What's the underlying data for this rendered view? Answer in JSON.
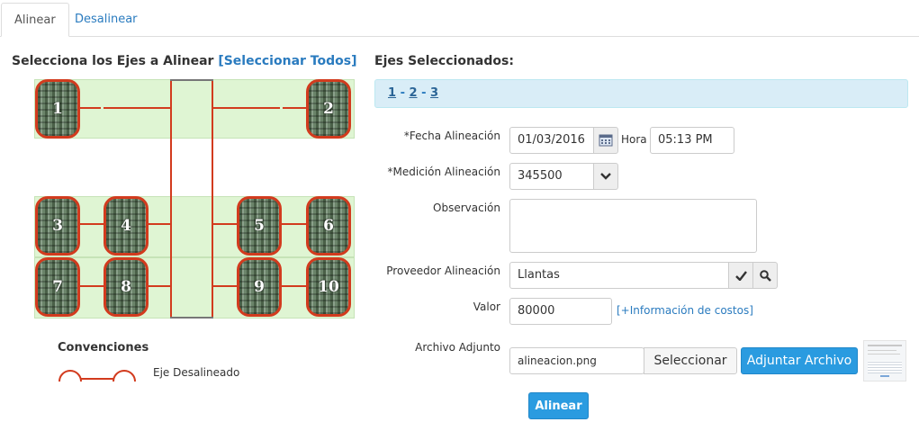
{
  "tabs": [
    {
      "label": "Alinear"
    },
    {
      "label": "Desalinear"
    }
  ],
  "left": {
    "heading": "Selecciona los Ejes a Alinear",
    "select_all": "[Seleccionar Todos]",
    "tires": [
      "1",
      "2",
      "3",
      "4",
      "5",
      "6",
      "7",
      "8",
      "9",
      "10"
    ],
    "legend_title": "Convenciones",
    "legend_label": "Eje Desalineado"
  },
  "right": {
    "heading": "Ejes Seleccionados:",
    "selected": [
      "1",
      "2",
      "3"
    ],
    "sep": " - ",
    "fecha_label": "*Fecha Alineación",
    "fecha_value": "01/03/2016",
    "hora_label": "Hora",
    "hora_value": "05:13 PM",
    "medicion_label": "*Medición Alineación",
    "medicion_value": "345500",
    "observacion_label": "Observación",
    "observacion_value": "",
    "proveedor_label": "Proveedor Alineación",
    "proveedor_value": "Llantas",
    "valor_label": "Valor",
    "valor_value": "80000",
    "info_costos": "[+Información de costos]",
    "archivo_label": "Archivo Adjunto",
    "archivo_value": "alineacion.png",
    "seleccionar_label": "Seleccionar",
    "adjuntar_label": "Adjuntar Archivo",
    "alinear_label": "Alinear"
  },
  "colors": {
    "accent": "#2a9be0",
    "link": "#2a7bbf",
    "axle": "#d23b1e",
    "band": "#dff5d3",
    "info_bg": "#d9edf7"
  }
}
